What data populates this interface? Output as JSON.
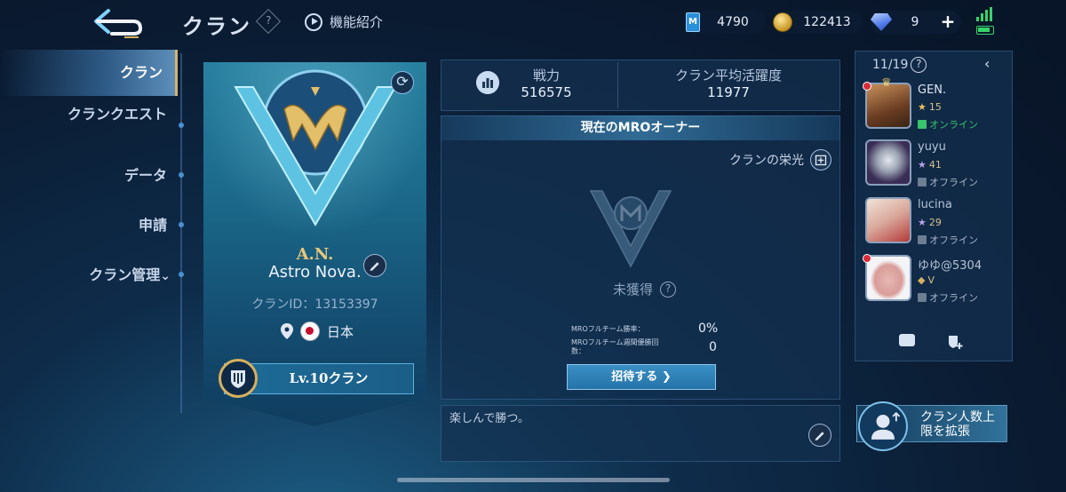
{
  "header": {
    "title": "クラン",
    "help_symbol": "?",
    "feature_intro": "機能紹介"
  },
  "currencies": {
    "ticket_icon_letter": "M",
    "ticket": "4790",
    "gold": "122413",
    "gems": "9",
    "plus": "+"
  },
  "sidebar": {
    "items": [
      {
        "label": "クラン"
      },
      {
        "label": "クランクエスト"
      },
      {
        "label": "データ"
      },
      {
        "label": "申請"
      },
      {
        "label": "クラン管理"
      }
    ],
    "manage_chevron": "⌄"
  },
  "clan": {
    "tag": "A.N.",
    "name": "Astro Nova.",
    "id_text": "クランID：13153397",
    "region": "日本",
    "level": "Lv.10クラン"
  },
  "stats": {
    "power_label": "戦力",
    "power_value": "516575",
    "activity_label": "クラン平均活躍度",
    "activity_value": "11977"
  },
  "mro": {
    "header": "現在のMROオーナー",
    "glory_label": "クランの栄光",
    "status": "未獲得",
    "help_symbol": "?",
    "win_rate_label": "MROフルチーム勝率：",
    "win_rate_value": "0%",
    "weekly_label": "MROフルチーム週間優勝回数：",
    "weekly_value": "0",
    "invite_label": "招待する",
    "invite_arrow": "❯"
  },
  "motto": "楽しんで勝つ。",
  "members": {
    "count": "11/19",
    "help_symbol": "?",
    "collapse_symbol": "‹",
    "list": [
      {
        "name": "GEN.",
        "rank": "15",
        "status": "オンライン",
        "online": true
      },
      {
        "name": "yuyu",
        "rank": "41",
        "status": "オフライン",
        "online": false
      },
      {
        "name": "lucina",
        "rank": "29",
        "status": "オフライン",
        "online": false
      },
      {
        "name": "ゆゆ@5304",
        "rank": "V",
        "status": "オフライン",
        "online": false
      }
    ]
  },
  "expand": {
    "line1": "クラン人数上",
    "line2": "限を拡張"
  },
  "colors": {
    "accent_gold": "#d6b15e",
    "online_green": "#38c36c",
    "panel_blue": "#1b6a8c"
  }
}
